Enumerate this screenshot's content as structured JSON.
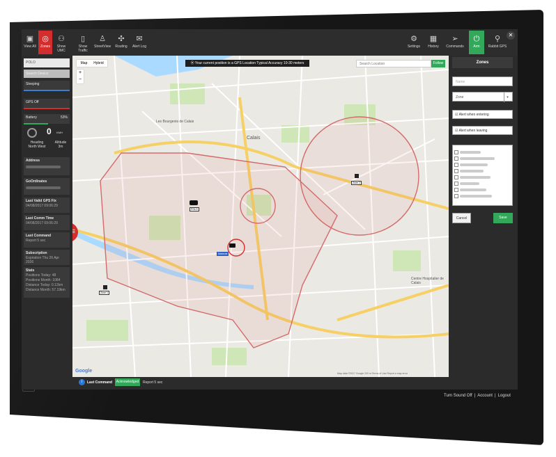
{
  "toolbar": {
    "left_buttons": [
      {
        "label": "View All",
        "icon": "car-icon"
      },
      {
        "label": "Zones",
        "icon": "zones-icon"
      },
      {
        "label": "Show UMC",
        "icon": "users-icon"
      },
      {
        "label": "Show Traffic",
        "icon": "traffic-light-icon"
      },
      {
        "label": "StreetView",
        "icon": "person-icon"
      },
      {
        "label": "Routing",
        "icon": "routing-icon"
      },
      {
        "label": "Alert Log",
        "icon": "envelope-icon"
      }
    ],
    "right_buttons": [
      {
        "label": "Settings",
        "icon": "gears-icon"
      },
      {
        "label": "History",
        "icon": "calendar-icon"
      },
      {
        "label": "Commands",
        "icon": "paper-plane-icon"
      },
      {
        "label": "Arm",
        "icon": "power-icon"
      },
      {
        "label": "Rabbit GPS",
        "icon": "search-icon"
      }
    ],
    "active": "Zones",
    "accent": "#d42d2d",
    "arm_color": "#33a85a"
  },
  "left_panel": {
    "device_name": "POLO",
    "search_placeholder": "Search Device",
    "sleeping_label": "Sleeping",
    "gps_label": "GPS Off",
    "battery_label": "Battery",
    "battery_value": "53%",
    "battery_level": 0.53,
    "speed_value": "0",
    "speed_unit": "KMH",
    "heading_label": "Heading",
    "heading_value": "North West",
    "altitude_label": "Altitude",
    "altitude_value": "3m",
    "address_label": "Address",
    "coordinates_label": "GoOrdinates",
    "last_fix_label": "Last Valid GPS Fix",
    "last_fix_value": "04/08/2017 09:06:29",
    "last_comm_label": "Last Comm Time",
    "last_comm_value": "04/08/2017 09:06:29",
    "last_command_label": "Last Command",
    "last_command_value": "Report 5 sec",
    "subscription_label": "Subscription",
    "subscription_value": "Expiration Thu 26 Apr 2026",
    "stats_label": "Stats",
    "stats": [
      "Positions Today: 48",
      "Positions Month: 1084",
      "Distance Today: 0.12km",
      "Distance Month: 57.19km"
    ]
  },
  "map": {
    "gps_banner": "Your current position is a GPS Location Typical Accuracy 10-30 meters",
    "search_placeholder": "Search Location",
    "follow_label": "Follow",
    "map_type_map": "Map",
    "map_type_hybrid": "Hybrid",
    "zoom_in": "+",
    "zoom_out": "−",
    "google_logo": "Google",
    "map_data": "Map data ©2017 Google   200 m    Terms of Use   Report a map error",
    "city_labels": [
      "Calais",
      "Les Bourgeois de Calais",
      "Centre Hospitalier de Calais"
    ],
    "markers": [
      {
        "label": "POLO",
        "style": "plain"
      },
      {
        "label": "Zone 2",
        "style": "plain"
      },
      {
        "label": "Zone 1",
        "style": "plain"
      },
      {
        "label": "Mabeole",
        "style": "blue"
      }
    ],
    "geofence_color": "#d46a6a"
  },
  "status_bar": {
    "label": "Last Command",
    "state": "Acknowledged",
    "value": "Report 5 sec"
  },
  "zones_panel": {
    "title": "Zones",
    "name_placeholder": "Name",
    "type_value": "Zone",
    "alert_enter_label": "Alert when entering",
    "alert_leave_label": "Alert when leaving",
    "cancel_label": "Cancel",
    "save_label": "Save"
  },
  "footer": {
    "sound_label": "Turn Sound Off",
    "account_label": "Account",
    "logout_label": "Logout"
  }
}
